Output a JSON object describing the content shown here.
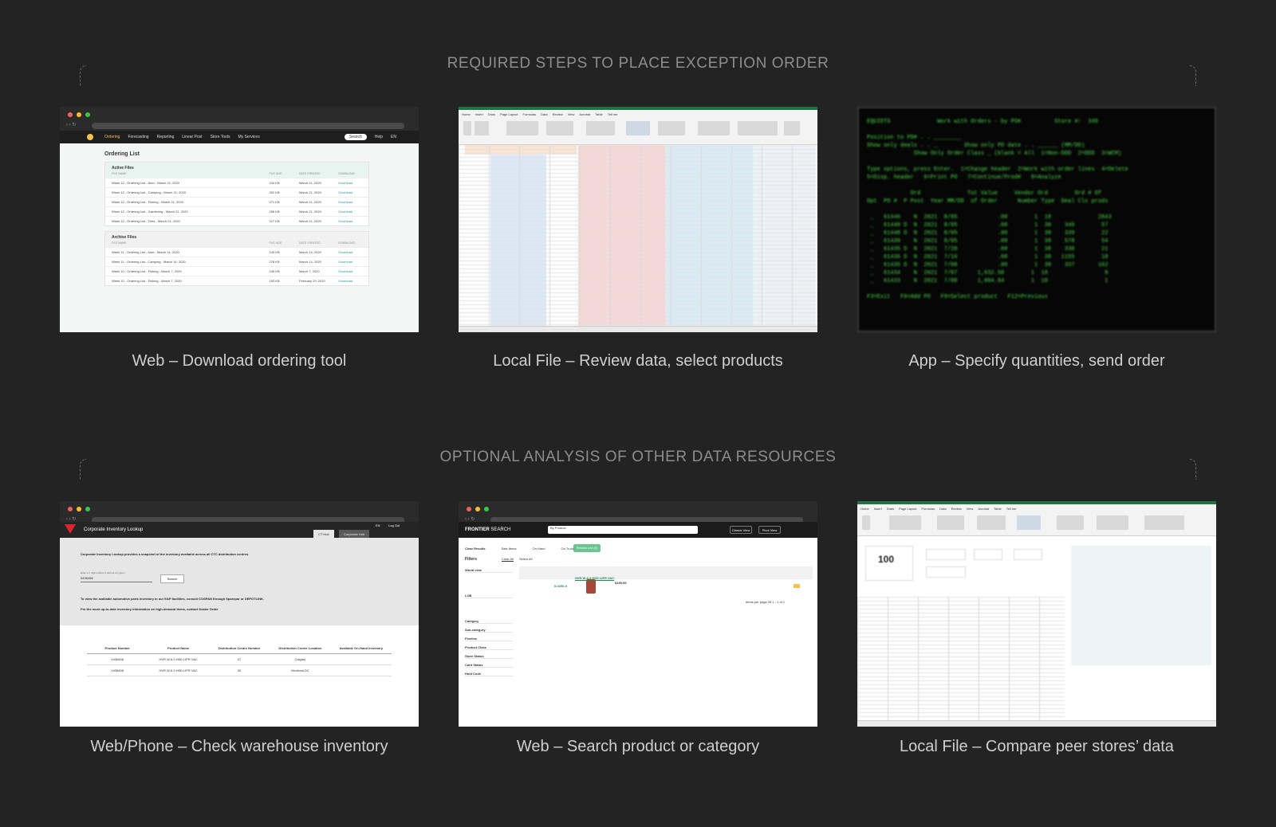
{
  "sections": {
    "required": "REQUIRED STEPS TO PLACE EXCEPTION ORDER",
    "optional": "OPTIONAL ANALYSIS OF OTHER DATA RESOURCES"
  },
  "captions": {
    "step1": "Web – Download ordering tool",
    "step2": "Local File – Review data, select products",
    "step3": "App – Specify quantities, send order",
    "opt1": "Web/Phone – Check warehouse inventory",
    "opt2": "Web – Search product or category",
    "opt3": "Local File – Compare peer stores’ data"
  },
  "ordering_tool": {
    "nav": [
      "Ordering",
      "Forecasting",
      "Reporting",
      "Linear Post",
      "Store Tools",
      "My Services"
    ],
    "search": "Search",
    "help": "Help",
    "lang": "EN",
    "title": "Ordering List",
    "active_header": "Active Files",
    "archive_header": "Archive Files",
    "columns": [
      "FILE NAME",
      "FILE SIZE",
      "DATE CREATED",
      "DOWNLOAD"
    ],
    "active": [
      [
        "Week 12 - Ordering List - Auto - March 21, 2020",
        "234 KB",
        "March 21, 2020",
        "Download"
      ],
      [
        "Week 12 - Ordering List - Camping - March 21, 2020",
        "302 KB",
        "March 21, 2020",
        "Download"
      ],
      [
        "Week 12 - Ordering List - Fishing - March 21, 2020",
        "271 KB",
        "March 21, 2020",
        "Download"
      ],
      [
        "Week 12 - Ordering List - Gardening - March 21, 2020",
        "256 KB",
        "March 21, 2020",
        "Download"
      ],
      [
        "Week 12 - Ordering List - Tires - March 21, 2020",
        "317 KB",
        "March 21, 2020",
        "Download"
      ]
    ],
    "archive": [
      [
        "Week 11 - Ordering List - Auto - March 14, 2020",
        "243 KB",
        "March 14, 2020",
        "Download"
      ],
      [
        "Week 11 - Ordering List - Camping - March 14, 2020",
        "278 KB",
        "March 14, 2020",
        "Download"
      ],
      [
        "Week 10 - Ordering List - Fishing - March 7, 2020",
        "249 KB",
        "March 7, 2020",
        "Download"
      ],
      [
        "Week 10 - Ordering List - Fishing - March 7, 2020",
        "193 KB",
        "February 29, 2020",
        "Download"
      ]
    ]
  },
  "excel": {
    "tabs": [
      "Home",
      "Insert",
      "Draw",
      "Page Layout",
      "Formulas",
      "Data",
      "Review",
      "View",
      "Acrobat",
      "Table",
      "Tell me"
    ]
  },
  "terminal": {
    "lines": [
      "EQUIDTS              Work with Orders - by PO#          Store #:  349",
      "",
      "Position to PO# . . ________",
      "Show only deals . . _        Show only PO date . . ______ (MM/DD)",
      "              Show Only Order Class _ (blank = All  1=Non-DDD  2=DDD  3=WCM)",
      "",
      "Type options, press Enter.  1=Change header  2=Work with order lines  4=Delete",
      "5=Disp. header   6=Print PO   7=Continue/Prod#   8=Analyze",
      "",
      "             Ord              Tot Value     Vendor Ord        Ord # Of",
      "Opt  PO #  P Post  Year MM/DD  of Order      Number Type  Deal Cls prods",
      "",
      " _   61446    N  2021  8/05            .00        1  18              2843",
      " _   61448 D  N  2021  8/05            .00        1  38    340        57",
      " _   61448 D  N  2021  8/05            .00        1  38    339        22",
      " _   61439    N  2021  8/05            .00        1  38    578        54",
      " _   61435 D  N  2021  7/28            .00        1  38    338        21",
      " _   61436 D  N  2021  7/16            .00        1  38   1155        18",
      " _   61435 D  N  2021  7/08            .00        1  38    337       162",
      " _   61434    N  2021  7/07      1,032.50        1  18                 8",
      " _   61433    N  2021  7/08      1,004.84        1  18                 1",
      "",
      "F3=Exit   F6=Add PO   F9=Select product   F12=Previous"
    ]
  },
  "inventory": {
    "title": "Corporate Inventory Lookup",
    "tab1": "CT Hub",
    "tab2": "Corporate Hub",
    "lang": "EN",
    "logout": "Log Out",
    "intro": "Corporate Inventory Lookup provides a snapshot of the inventory available across all CTC distribution centres.",
    "input_label": "Enter a 7 digit product # without a hyphen",
    "input_value": "0436458",
    "search_button": "Search",
    "note1": "To view the available automotive parts inventory in our E&P facilities, consult COSPAN through Sparepar or DEPOTLINK.",
    "note2": "For the most up-to-date inventory information on high-demand items, contact Dealer Order",
    "columns": [
      "Product Number",
      "Product Name",
      "Distribution Centre Number",
      "Distribution Centre Location",
      "Available On-Hand Inventory"
    ],
    "rows": [
      [
        "0436458",
        "HVR W-6.3 H5D LIPR VAC",
        "07",
        "Calgary",
        ""
      ],
      [
        "0436458",
        "HVR W-6.3 H5D LIPR VAC",
        "30",
        "Montreal DC",
        ""
      ]
    ]
  },
  "frontier": {
    "brand_bold": "FRONTIER",
    "brand_light": "SEARCH",
    "search_scope": "By Product",
    "classic_view": "Classic View",
    "pivot_view": "Pivot View",
    "tabs": [
      "Clear Results",
      "Sale Items",
      "On Hand",
      "On Truck"
    ],
    "review_button": "Review List (0)",
    "filters": "Filters",
    "clear_all": "Clear All",
    "select_all": "Select All",
    "facets": [
      "World view",
      "LOB",
      "Category",
      "Sub-category",
      "Fineline",
      "Product Class",
      "Store Status",
      "Card Status",
      "Hold Code"
    ],
    "product_no": "0-0250-0",
    "product_name": "HVR W-6.3 HSD LIPR VAC",
    "price": "$199.99",
    "pagination": "Items per page 25   1 - 1 of 1"
  }
}
